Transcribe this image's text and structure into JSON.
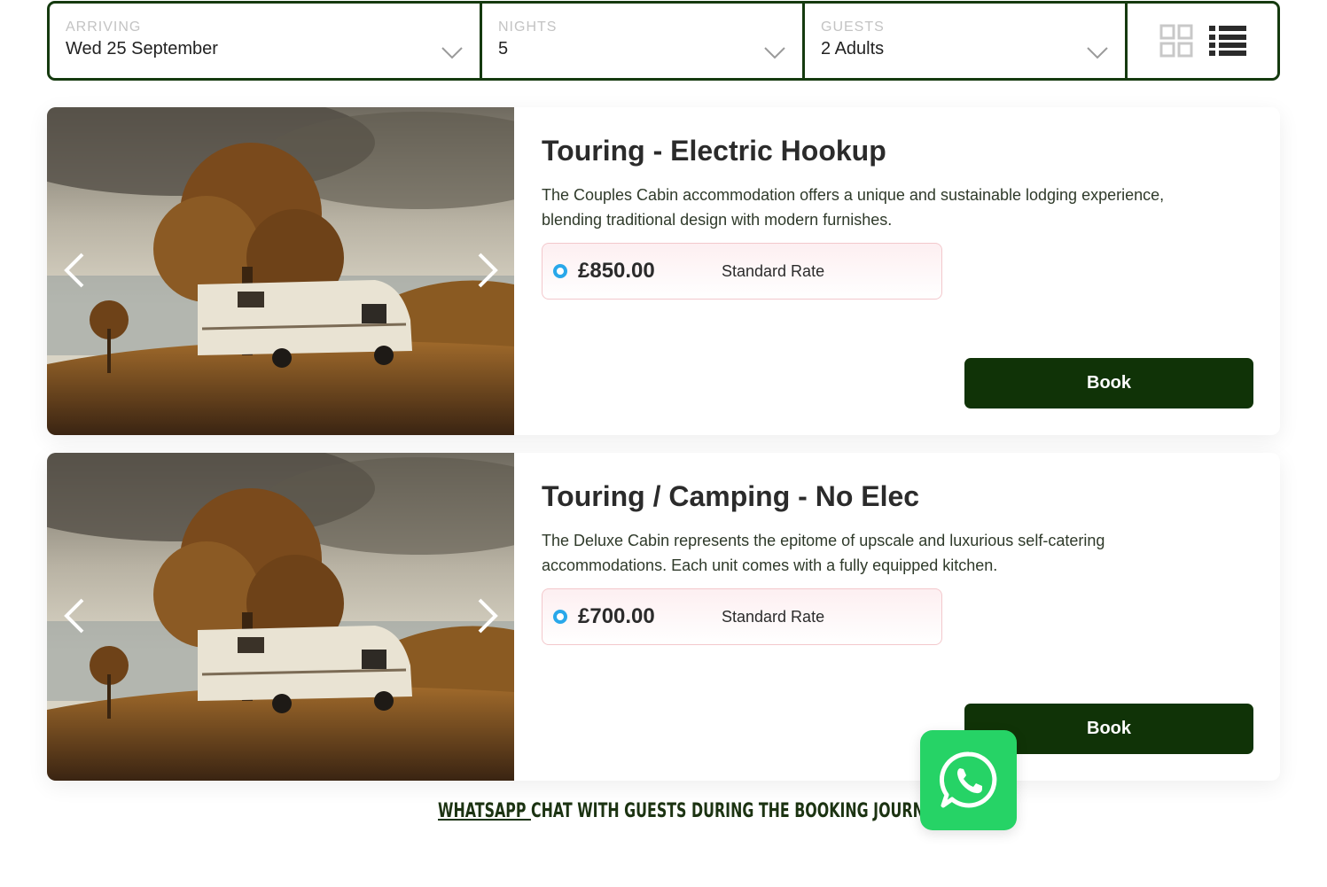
{
  "search": {
    "arriving": {
      "label": "ARRIVING",
      "value": "Wed 25 September"
    },
    "nights": {
      "label": "NIGHTS",
      "value": "5"
    },
    "guests": {
      "label": "GUESTS",
      "value": "2 Adults"
    },
    "view_icons": [
      "grid-view-icon",
      "list-view-icon"
    ]
  },
  "listings": [
    {
      "title": "Touring - Electric Hookup",
      "description": "The Couples Cabin accommodation offers a unique and sustainable lodging experience, blending traditional design with modern furnishes.",
      "price": "£850.00",
      "rate_name": "Standard Rate",
      "book_label": "Book"
    },
    {
      "title": "Touring / Camping - No Elec",
      "description": "The Deluxe Cabin represents the epitome of upscale and luxurious self-catering accommodations. Each unit comes with a fully equipped kitchen.",
      "price": "£700.00",
      "rate_name": "Standard Rate",
      "book_label": "Book"
    }
  ],
  "caption": {
    "link_text": "WhatsApp ",
    "text": "chat with guests during the booking journey"
  },
  "colors": {
    "brand_dark_green": "#103307",
    "whatsapp_green": "#26d366",
    "radio_blue": "#29a8ea"
  }
}
